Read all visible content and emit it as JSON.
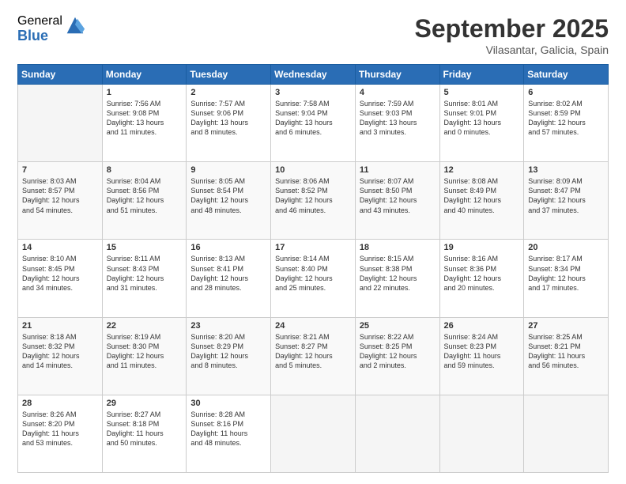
{
  "logo": {
    "general": "General",
    "blue": "Blue"
  },
  "header": {
    "title": "September 2025",
    "subtitle": "Vilasantar, Galicia, Spain"
  },
  "weekdays": [
    "Sunday",
    "Monday",
    "Tuesday",
    "Wednesday",
    "Thursday",
    "Friday",
    "Saturday"
  ],
  "weeks": [
    [
      {
        "day": "",
        "lines": []
      },
      {
        "day": "1",
        "lines": [
          "Sunrise: 7:56 AM",
          "Sunset: 9:08 PM",
          "Daylight: 13 hours",
          "and 11 minutes."
        ]
      },
      {
        "day": "2",
        "lines": [
          "Sunrise: 7:57 AM",
          "Sunset: 9:06 PM",
          "Daylight: 13 hours",
          "and 8 minutes."
        ]
      },
      {
        "day": "3",
        "lines": [
          "Sunrise: 7:58 AM",
          "Sunset: 9:04 PM",
          "Daylight: 13 hours",
          "and 6 minutes."
        ]
      },
      {
        "day": "4",
        "lines": [
          "Sunrise: 7:59 AM",
          "Sunset: 9:03 PM",
          "Daylight: 13 hours",
          "and 3 minutes."
        ]
      },
      {
        "day": "5",
        "lines": [
          "Sunrise: 8:01 AM",
          "Sunset: 9:01 PM",
          "Daylight: 13 hours",
          "and 0 minutes."
        ]
      },
      {
        "day": "6",
        "lines": [
          "Sunrise: 8:02 AM",
          "Sunset: 8:59 PM",
          "Daylight: 12 hours",
          "and 57 minutes."
        ]
      }
    ],
    [
      {
        "day": "7",
        "lines": [
          "Sunrise: 8:03 AM",
          "Sunset: 8:57 PM",
          "Daylight: 12 hours",
          "and 54 minutes."
        ]
      },
      {
        "day": "8",
        "lines": [
          "Sunrise: 8:04 AM",
          "Sunset: 8:56 PM",
          "Daylight: 12 hours",
          "and 51 minutes."
        ]
      },
      {
        "day": "9",
        "lines": [
          "Sunrise: 8:05 AM",
          "Sunset: 8:54 PM",
          "Daylight: 12 hours",
          "and 48 minutes."
        ]
      },
      {
        "day": "10",
        "lines": [
          "Sunrise: 8:06 AM",
          "Sunset: 8:52 PM",
          "Daylight: 12 hours",
          "and 46 minutes."
        ]
      },
      {
        "day": "11",
        "lines": [
          "Sunrise: 8:07 AM",
          "Sunset: 8:50 PM",
          "Daylight: 12 hours",
          "and 43 minutes."
        ]
      },
      {
        "day": "12",
        "lines": [
          "Sunrise: 8:08 AM",
          "Sunset: 8:49 PM",
          "Daylight: 12 hours",
          "and 40 minutes."
        ]
      },
      {
        "day": "13",
        "lines": [
          "Sunrise: 8:09 AM",
          "Sunset: 8:47 PM",
          "Daylight: 12 hours",
          "and 37 minutes."
        ]
      }
    ],
    [
      {
        "day": "14",
        "lines": [
          "Sunrise: 8:10 AM",
          "Sunset: 8:45 PM",
          "Daylight: 12 hours",
          "and 34 minutes."
        ]
      },
      {
        "day": "15",
        "lines": [
          "Sunrise: 8:11 AM",
          "Sunset: 8:43 PM",
          "Daylight: 12 hours",
          "and 31 minutes."
        ]
      },
      {
        "day": "16",
        "lines": [
          "Sunrise: 8:13 AM",
          "Sunset: 8:41 PM",
          "Daylight: 12 hours",
          "and 28 minutes."
        ]
      },
      {
        "day": "17",
        "lines": [
          "Sunrise: 8:14 AM",
          "Sunset: 8:40 PM",
          "Daylight: 12 hours",
          "and 25 minutes."
        ]
      },
      {
        "day": "18",
        "lines": [
          "Sunrise: 8:15 AM",
          "Sunset: 8:38 PM",
          "Daylight: 12 hours",
          "and 22 minutes."
        ]
      },
      {
        "day": "19",
        "lines": [
          "Sunrise: 8:16 AM",
          "Sunset: 8:36 PM",
          "Daylight: 12 hours",
          "and 20 minutes."
        ]
      },
      {
        "day": "20",
        "lines": [
          "Sunrise: 8:17 AM",
          "Sunset: 8:34 PM",
          "Daylight: 12 hours",
          "and 17 minutes."
        ]
      }
    ],
    [
      {
        "day": "21",
        "lines": [
          "Sunrise: 8:18 AM",
          "Sunset: 8:32 PM",
          "Daylight: 12 hours",
          "and 14 minutes."
        ]
      },
      {
        "day": "22",
        "lines": [
          "Sunrise: 8:19 AM",
          "Sunset: 8:30 PM",
          "Daylight: 12 hours",
          "and 11 minutes."
        ]
      },
      {
        "day": "23",
        "lines": [
          "Sunrise: 8:20 AM",
          "Sunset: 8:29 PM",
          "Daylight: 12 hours",
          "and 8 minutes."
        ]
      },
      {
        "day": "24",
        "lines": [
          "Sunrise: 8:21 AM",
          "Sunset: 8:27 PM",
          "Daylight: 12 hours",
          "and 5 minutes."
        ]
      },
      {
        "day": "25",
        "lines": [
          "Sunrise: 8:22 AM",
          "Sunset: 8:25 PM",
          "Daylight: 12 hours",
          "and 2 minutes."
        ]
      },
      {
        "day": "26",
        "lines": [
          "Sunrise: 8:24 AM",
          "Sunset: 8:23 PM",
          "Daylight: 11 hours",
          "and 59 minutes."
        ]
      },
      {
        "day": "27",
        "lines": [
          "Sunrise: 8:25 AM",
          "Sunset: 8:21 PM",
          "Daylight: 11 hours",
          "and 56 minutes."
        ]
      }
    ],
    [
      {
        "day": "28",
        "lines": [
          "Sunrise: 8:26 AM",
          "Sunset: 8:20 PM",
          "Daylight: 11 hours",
          "and 53 minutes."
        ]
      },
      {
        "day": "29",
        "lines": [
          "Sunrise: 8:27 AM",
          "Sunset: 8:18 PM",
          "Daylight: 11 hours",
          "and 50 minutes."
        ]
      },
      {
        "day": "30",
        "lines": [
          "Sunrise: 8:28 AM",
          "Sunset: 8:16 PM",
          "Daylight: 11 hours",
          "and 48 minutes."
        ]
      },
      {
        "day": "",
        "lines": []
      },
      {
        "day": "",
        "lines": []
      },
      {
        "day": "",
        "lines": []
      },
      {
        "day": "",
        "lines": []
      }
    ]
  ]
}
